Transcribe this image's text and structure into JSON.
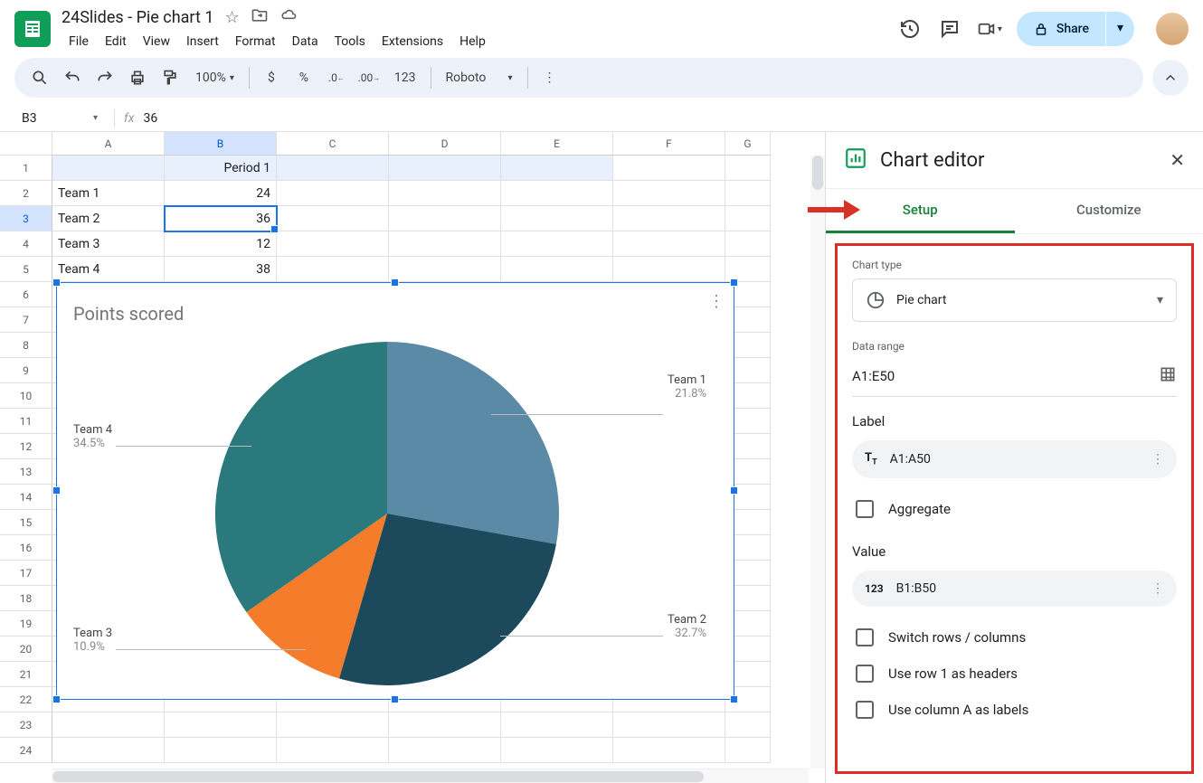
{
  "doc_title": "24Slides - Pie chart 1",
  "menubar": [
    "File",
    "Edit",
    "View",
    "Insert",
    "Format",
    "Data",
    "Tools",
    "Extensions",
    "Help"
  ],
  "toolbar": {
    "zoom": "100%",
    "currency": "$",
    "percent": "%",
    "num_fmt": "123",
    "font": "Roboto"
  },
  "share_label": "Share",
  "name_box": "B3",
  "fx_value": "36",
  "columns": [
    "A",
    "B",
    "C",
    "D",
    "E",
    "F",
    "G"
  ],
  "sheet": {
    "A1": "",
    "B1": "Period 1",
    "A2": "Team 1",
    "B2": "24",
    "A3": "Team 2",
    "B3": "36",
    "A4": "Team 3",
    "B4": "12",
    "A5": "Team 4",
    "B5": "38"
  },
  "chart": {
    "title": "Points scored",
    "labels": {
      "t1": {
        "name": "Team 1",
        "pct": "21.8%"
      },
      "t2": {
        "name": "Team 2",
        "pct": "32.7%"
      },
      "t3": {
        "name": "Team 3",
        "pct": "10.9%"
      },
      "t4": {
        "name": "Team 4",
        "pct": "34.5%"
      }
    }
  },
  "editor": {
    "title": "Chart editor",
    "tab_setup": "Setup",
    "tab_customize": "Customize",
    "chart_type_label": "Chart type",
    "chart_type_value": "Pie chart",
    "data_range_label": "Data range",
    "data_range_value": "A1:E50",
    "label_section": "Label",
    "label_value": "A1:A50",
    "aggregate": "Aggregate",
    "value_section": "Value",
    "value_value": "B1:B50",
    "switch_rows": "Switch rows / columns",
    "row1_headers": "Use row 1 as headers",
    "colA_labels": "Use column A as labels"
  },
  "chart_data": {
    "type": "pie",
    "title": "Points scored",
    "categories": [
      "Team 1",
      "Team 2",
      "Team 3",
      "Team 4"
    ],
    "values": [
      24,
      36,
      12,
      38
    ],
    "percentages": [
      21.8,
      32.7,
      10.9,
      34.5
    ],
    "colors": [
      "#5b8aa6",
      "#1c4a5c",
      "#f47c2b",
      "#2a7a7d"
    ]
  }
}
